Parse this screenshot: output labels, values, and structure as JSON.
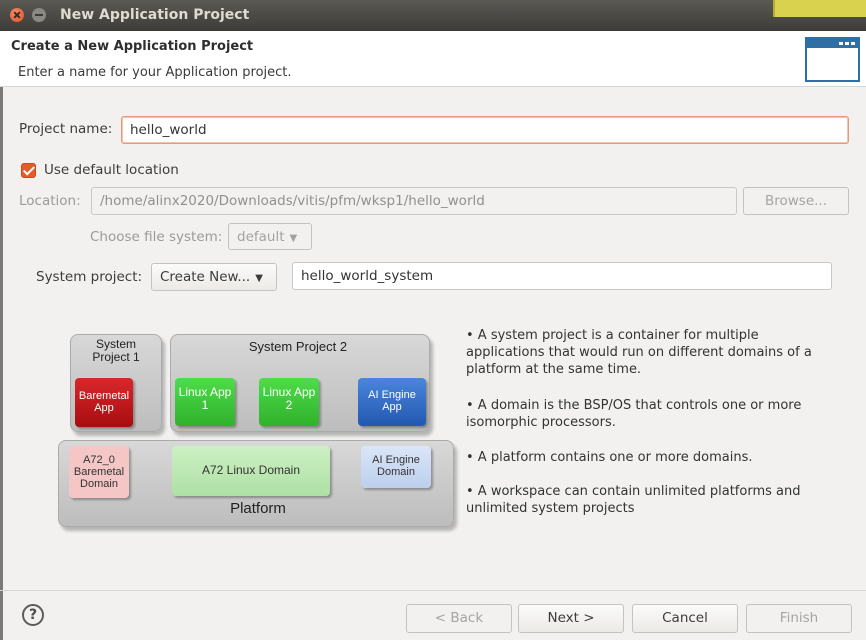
{
  "window": {
    "title": "New Application Project"
  },
  "header": {
    "title": "Create a New Application Project",
    "subtitle": "Enter a name for your Application project."
  },
  "form": {
    "project_name_label": "Project name:",
    "project_name_value": "hello_world",
    "use_default_location_label": "Use default location",
    "use_default_location_checked": true,
    "location_label": "Location:",
    "location_value": "/home/alinx2020/Downloads/vitis/pfm/wksp1/hello_world",
    "browse_label": "Browse...",
    "file_system_label": "Choose file system:",
    "file_system_value": "default",
    "system_project_label": "System project:",
    "system_project_mode": "Create New...",
    "system_project_name": "hello_world_system"
  },
  "diagram": {
    "system_project_1": "System Project 1",
    "system_project_2": "System Project 2",
    "baremetal_app": "Baremetal App",
    "linux_app_1": "Linux App 1",
    "linux_app_2": "Linux App 2",
    "ai_engine_app": "AI Engine App",
    "a72_baremetal_domain": "A72_0 Baremetal Domain",
    "a72_linux_domain": "A72 Linux Domain",
    "ai_engine_domain": "AI Engine Domain",
    "platform": "Platform"
  },
  "info": [
    "• A system project is a container for multiple applications that would run on different domains of a platform at the same time.",
    "• A domain is the BSP/OS that controls one or more isomorphic processors.",
    "• A platform contains one or more domains.",
    "• A workspace can contain unlimited platforms and unlimited system projects"
  ],
  "buttons": {
    "help": "?",
    "back": "< Back",
    "next": "Next >",
    "cancel": "Cancel",
    "finish": "Finish"
  },
  "colors": {
    "accent": "#e45b2b",
    "link_blue": "#2f6fa5",
    "baremetal_app": "#c8141c",
    "linux_app": "#3cc63c",
    "ai_engine_app": "#2f6fc8",
    "baremetal_domain": "#f2c4c4",
    "linux_domain": "#bce8b4",
    "ai_engine_domain": "#c8d8f0"
  }
}
